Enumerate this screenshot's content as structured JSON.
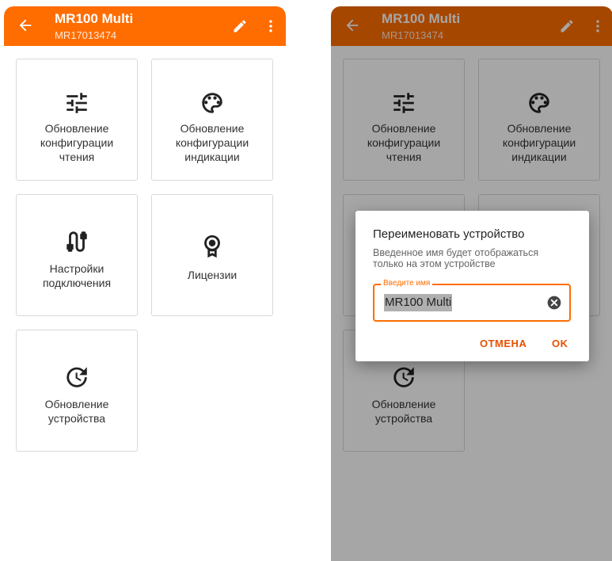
{
  "device": {
    "title": "MR100 Multi",
    "serial": "MR17013474"
  },
  "tiles": [
    {
      "label": "Обновление\nконфигурации\nчтения",
      "icon": "tune-sliders-icon"
    },
    {
      "label": "Обновление\nконфигурации\nиндикации",
      "icon": "palette-icon"
    },
    {
      "label": "Настройки\nподключения",
      "icon": "cable-connector-icon"
    },
    {
      "label": "Лицензии",
      "icon": "license-badge-icon"
    },
    {
      "label": "Обновление\nустройства",
      "icon": "update-history-icon"
    }
  ],
  "dialog": {
    "title": "Переименовать устройство",
    "message": "Введенное имя будет отображаться\nтолько на этом устройстве",
    "field_label": "Введите имя",
    "field_value": "MR100 Multi",
    "cancel_label": "ОТМЕНА",
    "ok_label": "OK"
  },
  "colors": {
    "accent": "#ff6d00",
    "accent_dark": "#e65100",
    "scrim": "rgba(0,0,0,0.35)"
  }
}
